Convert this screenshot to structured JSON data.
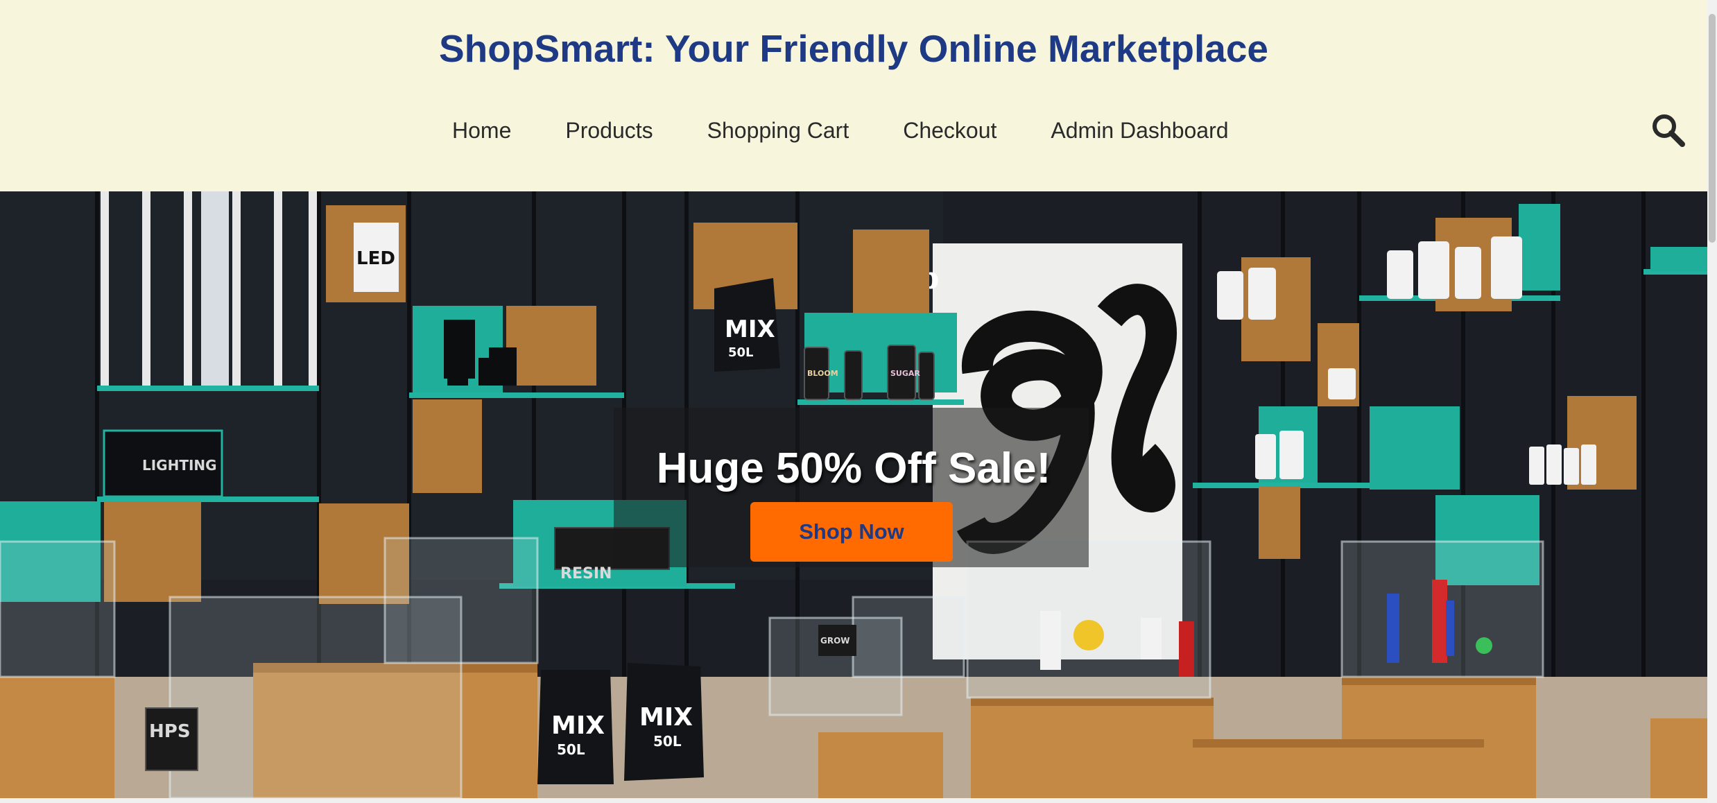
{
  "header": {
    "title": "ShopSmart: Your Friendly Online Marketplace",
    "bg_color": "#f7f5dc",
    "title_color": "#1f3a85"
  },
  "nav": {
    "items": [
      {
        "label": "Home"
      },
      {
        "label": "Products"
      },
      {
        "label": "Shopping Cart"
      },
      {
        "label": "Checkout"
      },
      {
        "label": "Admin Dashboard"
      }
    ],
    "search_icon": "search-icon"
  },
  "hero": {
    "heading": "Huge 50% Off Sale!",
    "cta_label": "Shop Now",
    "cta_color": "#ff6b00",
    "image_description_icon": "store-interior-photo",
    "photo_text": {
      "led": "LED",
      "lighting": "LIGHTING",
      "gb": "gb",
      "mix_bag_1": "MIX",
      "mix_bag_1_size": "50L",
      "mix_bag_2": "MIX",
      "mix_bag_2_size": "50L",
      "mix_bag_3": "MIX",
      "mix_bag_3_size": "50L",
      "resin": "RESIN",
      "hps": "HPS",
      "bloom": "BLOOM",
      "sugar": "SUGAR",
      "grow": "GROW"
    }
  }
}
